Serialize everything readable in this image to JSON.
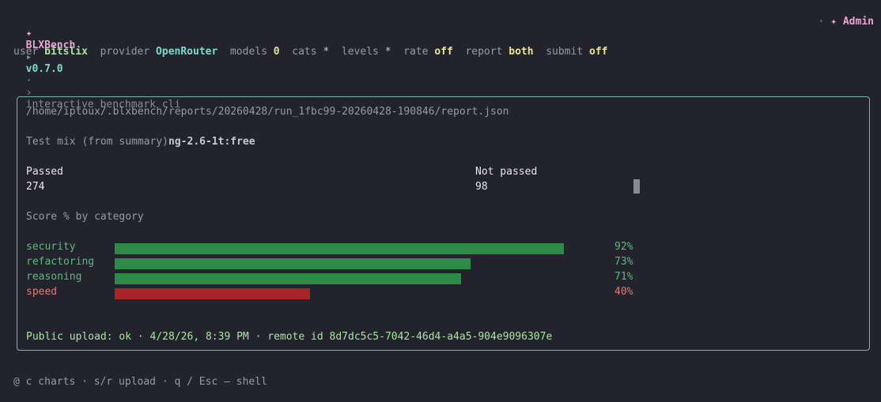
{
  "header": {
    "brand_symbol": "✦",
    "brand": "BLXBench",
    "arrow": "▸",
    "version": "v0.7.0",
    "sep": "·",
    "crumb_arrow": "›",
    "subtitle": "interactive benchmark cli",
    "right_sep": "·",
    "admin_symbol": "✦",
    "admin": "Admin"
  },
  "status": {
    "user_key": "user",
    "user_val": "bitslix",
    "provider_key": "provider",
    "provider_val": "OpenRouter",
    "models_key": "models",
    "models_val": "0",
    "cats_key": "cats",
    "cats_val": "*",
    "levels_key": "levels",
    "levels_val": "*",
    "rate_key": "rate",
    "rate_val": "off",
    "report_key": "report",
    "report_val": "both",
    "submit_key": "submit",
    "submit_val": "off"
  },
  "report": {
    "path": "/home/iptoux/.blxbench/reports/20260428/run_1fbc99-20260428-190846/report.json",
    "mix_label": "Test mix (from summary)",
    "mix_value": "ng-2.6-1t:free",
    "passed_label": "Passed",
    "passed_value": "274",
    "notpassed_label": "Not passed",
    "notpassed_value": "98",
    "score_title": "Score % by category",
    "categories": [
      {
        "name": "security",
        "value": 92,
        "label": "92%",
        "status": "good"
      },
      {
        "name": "refactoring",
        "value": 73,
        "label": "73%",
        "status": "good"
      },
      {
        "name": "reasoning",
        "value": 71,
        "label": "71%",
        "status": "good"
      },
      {
        "name": "speed",
        "value": 40,
        "label": "40%",
        "status": "bad"
      }
    ],
    "upload": "Public upload: ok · 4/28/26, 8:39 PM · remote id 8d7dc5c5-7042-46d4-a4a5-904e9096307e"
  },
  "colors": {
    "good_bar": "#2e8b47",
    "bad_bar": "#a82428",
    "border": "#6fb8ad"
  },
  "footer": {
    "text": "@ c charts · s/r upload · q / Esc — shell"
  }
}
